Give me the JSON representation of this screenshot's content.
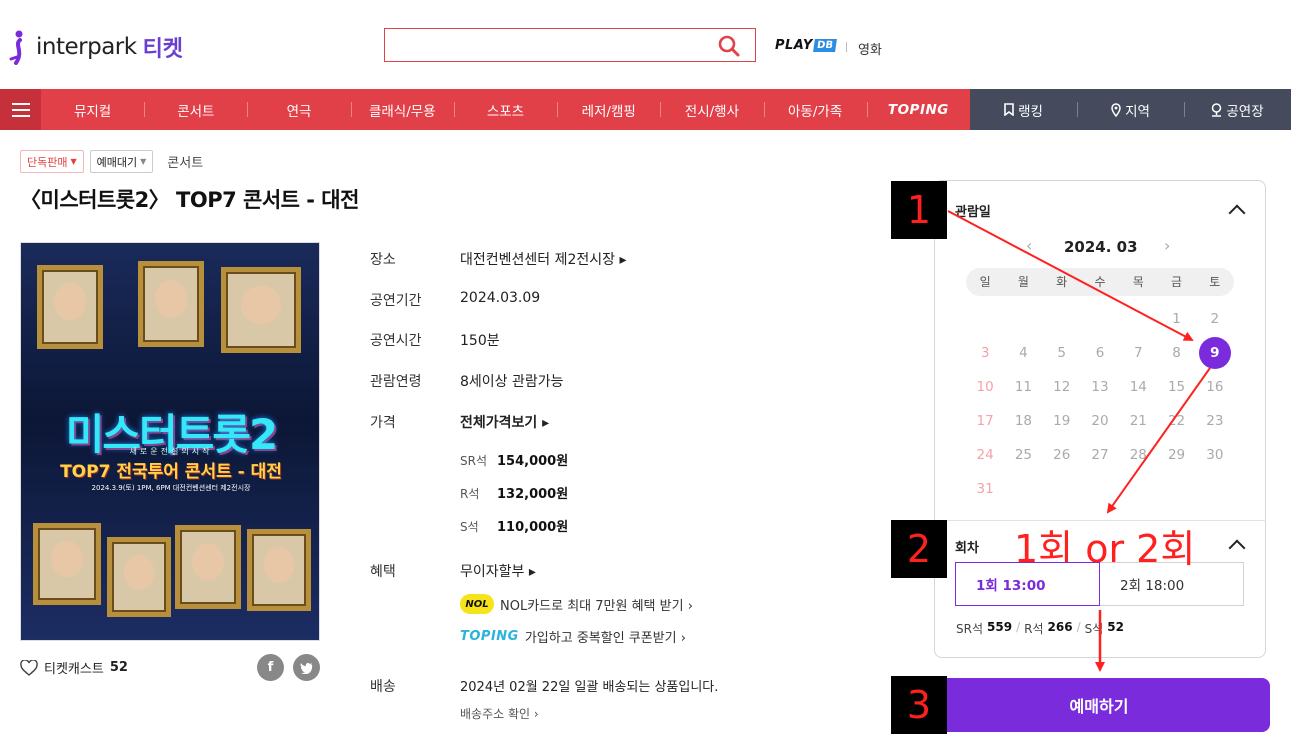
{
  "header": {
    "logo_text": "interpark",
    "logo_ticket": "티켓",
    "search_placeholder": "",
    "playdb_play": "PLAY",
    "playdb_db": "DB",
    "movie": "영화"
  },
  "nav": {
    "items": [
      "뮤지컬",
      "콘서트",
      "연극",
      "클래식/무용",
      "스포츠",
      "레저/캠핑",
      "전시/행사",
      "아동/가족",
      "TOPING"
    ],
    "right": [
      "랭킹",
      "지역",
      "공연장"
    ]
  },
  "tags": {
    "exclusive": "단독판매",
    "waiting": "예매대기",
    "genre": "콘서트"
  },
  "title": "〈미스터트롯2〉 TOP7 콘서트 - 대전",
  "poster": {
    "title": "미스터트롯2",
    "subtitle": "새로운전설의시작",
    "tour": "TOP7 전국투어 콘서트 - 대전",
    "date": "2024.3.9(토) 1PM, 6PM 대전컨벤션센터 제2전시장"
  },
  "likes": {
    "label": "티켓캐스트",
    "count": "52"
  },
  "social": {
    "facebook": "f",
    "twitter": "t"
  },
  "info": {
    "venue_label": "장소",
    "venue": "대전컨벤션센터 제2전시장 ▸",
    "period_label": "공연기간",
    "period": "2024.03.09",
    "duration_label": "공연시간",
    "duration": "150분",
    "age_label": "관람연령",
    "age": "8세이상 관람가능",
    "price_label": "가격",
    "price_all": "전체가격보기 ▸",
    "prices": [
      {
        "grade": "SR석",
        "amount": "154,000원"
      },
      {
        "grade": "R석",
        "amount": "132,000원"
      },
      {
        "grade": "S석",
        "amount": "110,000원"
      }
    ],
    "benefit_label": "혜택",
    "benefit_main": "무이자할부 ▸",
    "benefit_nol_logo": "NOL",
    "benefit_nol": "NOL카드로 최대 7만원 혜택 받기 ›",
    "benefit_toping_logo": "TOPING",
    "benefit_toping": "가입하고 중복할인 쿠폰받기 ›",
    "delivery_label": "배송",
    "delivery": "2024년 02월 22일 일괄 배송되는 상품입니다.",
    "delivery_check": "배송주소 확인 ›"
  },
  "panel": {
    "date_title": "관람일",
    "month": "2024. 03",
    "prev": "‹",
    "next": "›",
    "dow": [
      "일",
      "월",
      "화",
      "수",
      "목",
      "금",
      "토"
    ],
    "days": [
      "",
      "",
      "",
      "",
      "",
      "1",
      "2",
      "3",
      "4",
      "5",
      "6",
      "7",
      "8",
      "9",
      "10",
      "11",
      "12",
      "13",
      "14",
      "15",
      "16",
      "17",
      "18",
      "19",
      "20",
      "21",
      "22",
      "23",
      "24",
      "25",
      "26",
      "27",
      "28",
      "29",
      "30",
      "31"
    ],
    "selected_day": "9",
    "round_title": "회차",
    "rounds": [
      "1회 13:00",
      "2회 18:00"
    ],
    "seats": [
      {
        "grade": "SR석",
        "count": "559"
      },
      {
        "grade": "R석",
        "count": "266"
      },
      {
        "grade": "S석",
        "count": "52"
      }
    ],
    "book": "예매하기"
  },
  "annotations": {
    "step1": "1",
    "step2": "2",
    "step3": "3",
    "note": "1회 or 2회",
    "color": "#ff2020"
  },
  "colors": {
    "brand_red": "#e24049",
    "purple": "#7a2bdc",
    "dark_nav": "#454b5d"
  }
}
